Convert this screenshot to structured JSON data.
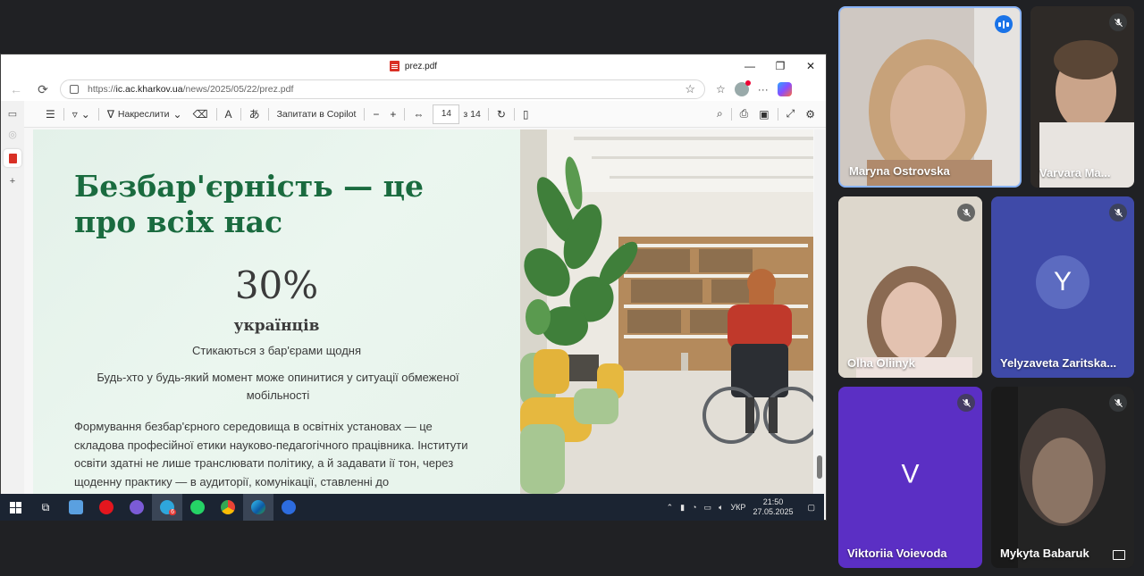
{
  "browser": {
    "tab_title": "prez.pdf",
    "url_prefix": "https://",
    "url_host": "ic.ac.kharkov.ua",
    "url_path": "/news/2025/05/22/prez.pdf"
  },
  "pdf_toolbar": {
    "draw_label": "Накреслити",
    "copilot_label": "Запитати в Copilot",
    "page_current": "14",
    "page_total": "з 14"
  },
  "slide": {
    "title": "Безбар'єрність — це про всіх нас",
    "stat_value": "30%",
    "stat_label": "українців",
    "stat_subtitle": "Стикаються з бар'єрами щодня",
    "stat_paragraph": "Будь-хто у будь-який момент може опинитися у ситуації обмеженої мобільності",
    "body_paragraph": "Формування безбар'єрного середовища в освітніх установах — це складова професійної етики науково-педагогічного працівника. Інститути освіти здатні не лише транслювати політику, а й задавати ії тон, через щоденну практику — в аудиторії, комунікації, ставленні до"
  },
  "taskbar": {
    "language": "УКР",
    "time": "21:50",
    "date": "27.05.2025",
    "badge": "6"
  },
  "participants": [
    {
      "name": "Maryna Ostrovska",
      "state": "speaking"
    },
    {
      "name": "Varvara Ma...",
      "state": "muted"
    },
    {
      "name": "Olha Oliinyk",
      "state": "muted"
    },
    {
      "name": "Yelyzaveta Zaritska...",
      "state": "muted",
      "initial": "Y"
    },
    {
      "name": "Viktoriia Voievoda",
      "state": "muted",
      "initial": "V"
    },
    {
      "name": "Mykyta Babaruk",
      "state": "muted"
    }
  ],
  "colors": {
    "title_green": "#1a6b3f",
    "meet_bg": "#202124",
    "speaking_blue": "#1a73e8",
    "violet_tile": "#5b2fc4",
    "indigo_tile": "#3f4aa8"
  }
}
